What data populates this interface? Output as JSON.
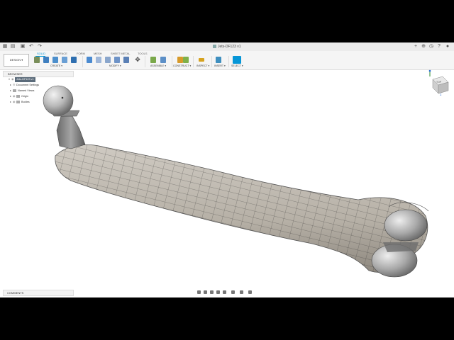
{
  "window": {
    "document_title": "Jets-DF123 v1"
  },
  "toolbar": {
    "workspace_button": "DESIGN ▾",
    "tabs": [
      {
        "label": "SOLID",
        "active": true
      },
      {
        "label": "SURFACE",
        "active": false
      },
      {
        "label": "FORM",
        "active": false
      },
      {
        "label": "MESH",
        "active": false
      },
      {
        "label": "SHEET METAL",
        "active": false
      },
      {
        "label": "TOOLS",
        "active": false
      }
    ],
    "groups": {
      "create": "CREATE ▾",
      "modify": "MODIFY ▾",
      "assemble": "ASSEMBLE ▾",
      "construct": "CONSTRUCT ▾",
      "inspect": "INSPECT ▾",
      "insert": "INSERT ▾",
      "select": "SELECT ▾"
    }
  },
  "browser": {
    "title": "BROWSER",
    "root": "Jets-DF123 v1",
    "items": [
      "Document Settings",
      "Named Views",
      "Origin",
      "Bodies"
    ]
  },
  "comments": {
    "title": "COMMENTS"
  },
  "viewcube": {
    "face_label": "TOP"
  },
  "colors": {
    "accent": "#0696d7",
    "bone": "#b6b0a6",
    "metal": "#c9c9c9"
  }
}
